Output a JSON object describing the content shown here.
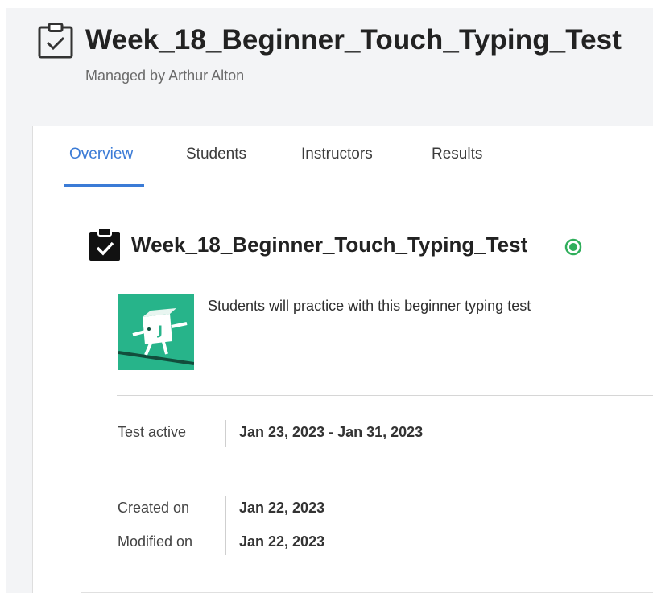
{
  "header": {
    "title": "Week_18_Beginner_Touch_Typing_Test",
    "managed_by": "Managed by Arthur Alton",
    "icon": "clipboard-check-outline-icon"
  },
  "tabs": [
    {
      "label": "Overview",
      "active": true
    },
    {
      "label": "Students",
      "active": false
    },
    {
      "label": "Instructors",
      "active": false
    },
    {
      "label": "Results",
      "active": false
    }
  ],
  "test": {
    "title": "Week_18_Beginner_Touch_Typing_Test",
    "icon": "clipboard-check-filled-icon",
    "status_icon": "active-status-dot-icon",
    "thumbnail_icon": "typing-mascot-icon",
    "description": "Students will practice with this beginner typing test"
  },
  "details": {
    "test_active_label": "Test active",
    "test_active_value": "Jan 23, 2023 - Jan 31, 2023",
    "created_label": "Created on",
    "created_value": "Jan 22, 2023",
    "modified_label": "Modified on",
    "modified_value": "Jan 22, 2023"
  },
  "colors": {
    "accent": "#3b7bd6",
    "status_green": "#2fae5b",
    "thumbnail_bg": "#27b48a",
    "background": "#f3f4f6"
  }
}
